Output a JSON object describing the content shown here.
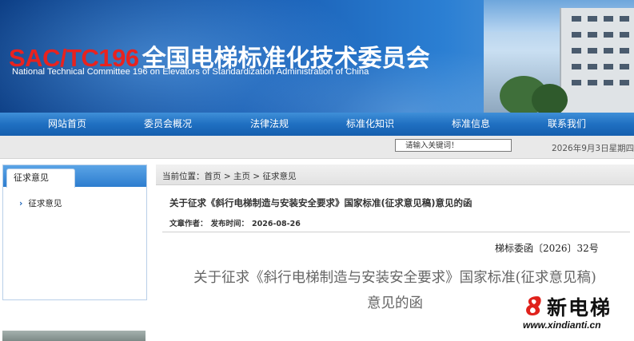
{
  "banner": {
    "code": "SAC/TC196",
    "title_cn": "全国电梯标准化技术委员会",
    "subtitle_en": "National Technical Committee 196 on Elevators of Standardization Administration of China"
  },
  "nav": {
    "items": [
      {
        "label": "网站首页"
      },
      {
        "label": "委员会概况"
      },
      {
        "label": "法律法规"
      },
      {
        "label": "标准化知识"
      },
      {
        "label": "标准信息"
      },
      {
        "label": "联系我们"
      }
    ]
  },
  "topbar": {
    "search_placeholder": "请输入关键词！",
    "date": "2026年9月3日星期四"
  },
  "sidebar": {
    "heading": "征求意见",
    "items": [
      {
        "label": "征求意见"
      }
    ]
  },
  "breadcrumb": {
    "text": "当前位置：首页 > 主页 > 征求意见"
  },
  "article": {
    "title": "关于征求《斜行电梯制造与安装安全要求》国家标准(征求意见稿)意见的函",
    "author_label": "文章作者：",
    "published_label": "发布时间：",
    "published_date": "2026-08-26",
    "doc_number": "梯标委函〔2026〕32号",
    "heading_line1": "关于征求《斜行电梯制造与安装安全要求》国家标准(征求意见稿)",
    "heading_line2": "意见的函"
  },
  "watermark": {
    "brand": "新电梯",
    "url": "www.xindianti.cn"
  },
  "colors": {
    "nav_blue": "#1f6fc1",
    "code_red": "#e8221f",
    "banner_blue": "#1b62b8"
  }
}
